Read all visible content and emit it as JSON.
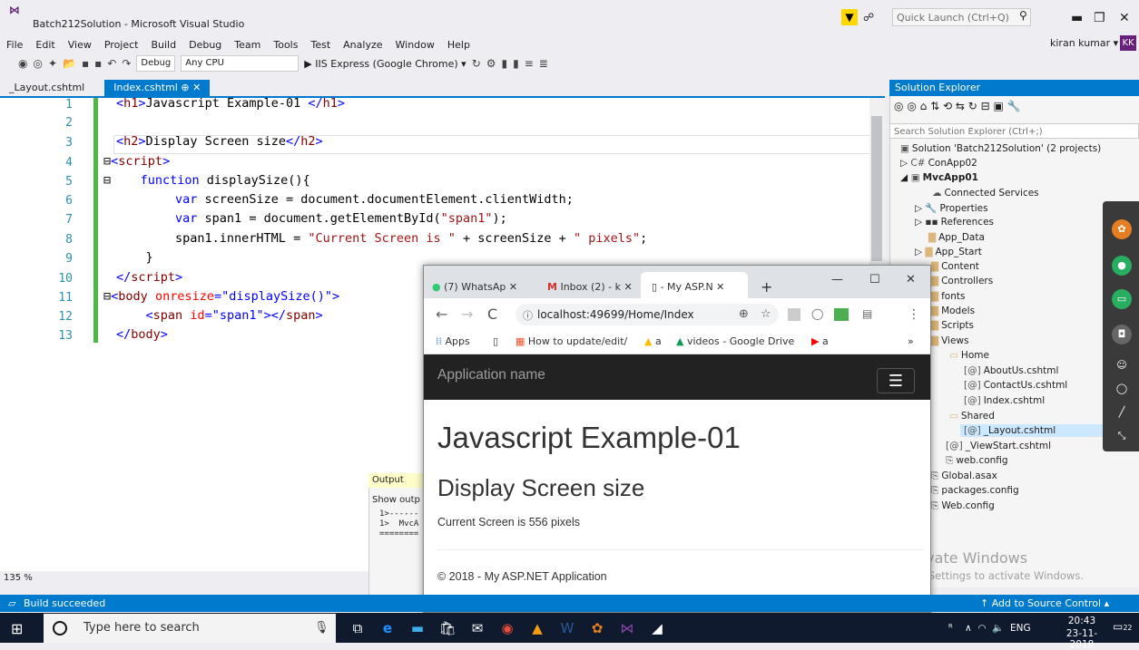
{
  "app": {
    "title": "Batch212Solution - Microsoft Visual Studio",
    "quick_launch_placeholder": "Quick Launch (Ctrl+Q)",
    "user_name": "kiran kumar ▾",
    "user_initials": "KK"
  },
  "menu": [
    "File",
    "Edit",
    "View",
    "Project",
    "Build",
    "Debug",
    "Team",
    "Tools",
    "Test",
    "Analyze",
    "Window",
    "Help"
  ],
  "toolbar": {
    "config": "Debug",
    "platform": "Any CPU",
    "run_target": "▶ IIS Express (Google Chrome) ▾"
  },
  "doc_tabs": {
    "tab1": "_Layout.cshtml",
    "tab2": "Index.cshtml",
    "tab2_suffix": "⊕ ✕"
  },
  "editor": {
    "zoom": "135 %",
    "lines": [
      "1",
      "2",
      "3",
      "4",
      "5",
      "6",
      "7",
      "8",
      "9",
      "10",
      "11",
      "12",
      "13"
    ]
  },
  "solution_explorer": {
    "title": "Solution Explorer",
    "search_placeholder": "Search Solution Explorer (Ctrl+;)",
    "items": [
      "Solution 'Batch212Solution' (2 projects)",
      "ConApp02",
      "MvcApp01",
      "Connected Services",
      "Properties",
      "References",
      "App_Data",
      "App_Start",
      "Content",
      "Controllers",
      "fonts",
      "Models",
      "Scripts",
      "Views",
      "Home",
      "AboutUs.cshtml",
      "ContactUs.cshtml",
      "Index.cshtml",
      "Shared",
      "_Layout.cshtml",
      "_ViewStart.cshtml",
      "web.config",
      "Global.asax",
      "packages.config",
      "Web.config"
    ]
  },
  "output": {
    "title": "Output",
    "show": "Show outp",
    "text1": "1>------",
    "text2": "1>  MvcA",
    "text3": "========"
  },
  "status": {
    "text": "Build succeeded",
    "source_control": "↑ Add to Source Control ▴"
  },
  "watermark": {
    "line1": "Activate Windows",
    "line2": "Go to Settings to activate Windows."
  },
  "browser": {
    "tab1": "(7) WhatsAp",
    "tab2": "Inbox (2) - k",
    "tab3": "- My ASP.N",
    "url": "localhost:49699/Home/Index",
    "bookmarks": {
      "apps": "Apps",
      "b1": "How to update/edit/",
      "b2": "a",
      "b3": "videos - Google Drive",
      "b4": "a"
    },
    "app_name": "Application name",
    "h1": "Javascript Example-01",
    "h2": "Display Screen size",
    "span_text": "Current Screen is 556 pixels",
    "footer": "© 2018 - My ASP.NET Application"
  },
  "taskbar": {
    "search_placeholder": "Type here to search",
    "time": "20:43",
    "date": "23-11-2018",
    "lang": "ENG",
    "notif_count": "22"
  }
}
